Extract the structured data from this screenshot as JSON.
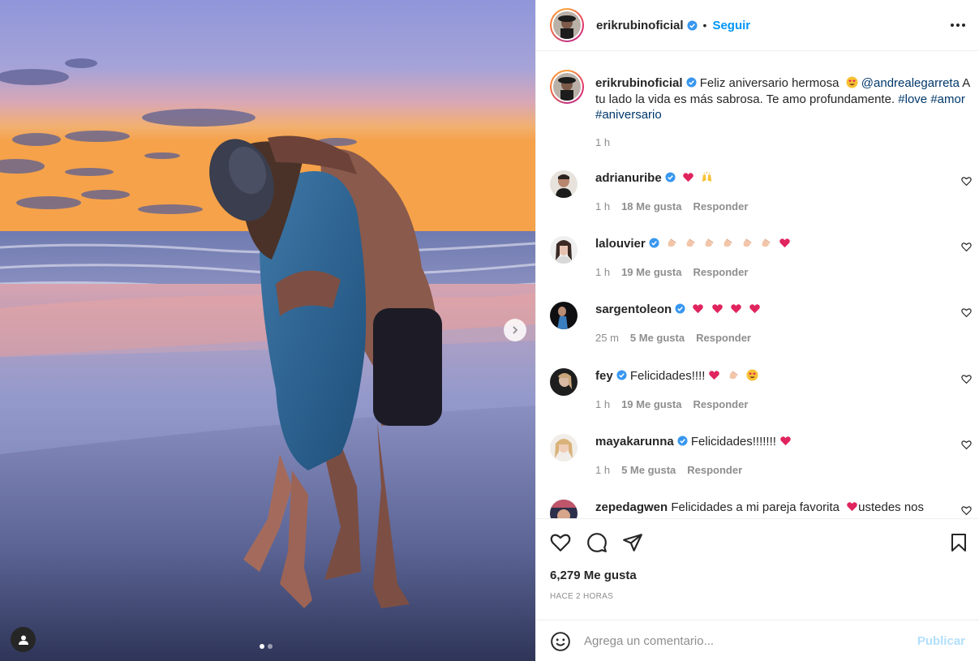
{
  "post": {
    "author": "erikrubinoficial",
    "follow_label": "Seguir",
    "separator": "•",
    "caption": {
      "username": "erikrubinoficial",
      "text_before_mention": "Feliz aniversario hermosa",
      "mention": "@andrealegarreta",
      "text_after_mention": "A tu lado la vida es más sabrosa. Te amo profundamente.",
      "hashtags": [
        "#love",
        "#amor",
        "#aniversario"
      ],
      "time": "1 h"
    },
    "carousel": {
      "slide_count": 2,
      "active_slide": 1
    }
  },
  "comments": [
    {
      "username": "adrianuribe",
      "verified": true,
      "text": "",
      "emojis": [
        "red-heart",
        "raising-hands"
      ],
      "time": "1 h",
      "likes": "18 Me gusta",
      "reply": "Responder"
    },
    {
      "username": "lalouvier",
      "verified": true,
      "text": "",
      "emojis": [
        "clapping-hands",
        "clapping-hands",
        "clapping-hands",
        "clapping-hands",
        "clapping-hands",
        "clapping-hands",
        "red-heart"
      ],
      "time": "1 h",
      "likes": "19 Me gusta",
      "reply": "Responder"
    },
    {
      "username": "sargentoleon",
      "verified": true,
      "text": "",
      "emojis": [
        "red-heart",
        "red-heart",
        "red-heart",
        "red-heart"
      ],
      "time": "25 m",
      "likes": "5 Me gusta",
      "reply": "Responder"
    },
    {
      "username": "fey",
      "verified": true,
      "text": "Felicidades!!!!",
      "emojis": [
        "red-heart",
        "clapping-hands",
        "heart-eyes"
      ],
      "time": "1 h",
      "likes": "19 Me gusta",
      "reply": "Responder"
    },
    {
      "username": "mayakarunna",
      "verified": true,
      "text": "Felicidades!!!!!!!",
      "emojis": [
        "red-heart"
      ],
      "time": "1 h",
      "likes": "5 Me gusta",
      "reply": "Responder"
    },
    {
      "username": "zepedagwen",
      "verified": false,
      "text": "Felicidades a mi pareja favorita",
      "emojis": [
        "red-heart"
      ],
      "text_after": "ustedes nos",
      "time": "",
      "likes": "",
      "reply": ""
    }
  ],
  "footer": {
    "likes_total": "6,279 Me gusta",
    "posted_ago": "HACE 2 HORAS",
    "comment_placeholder": "Agrega un comentario...",
    "publish_label": "Publicar"
  },
  "colors": {
    "accent": "#0095f6",
    "verified": "#3897f0",
    "heart": "#ed4956",
    "muted": "#8e8e8e"
  }
}
